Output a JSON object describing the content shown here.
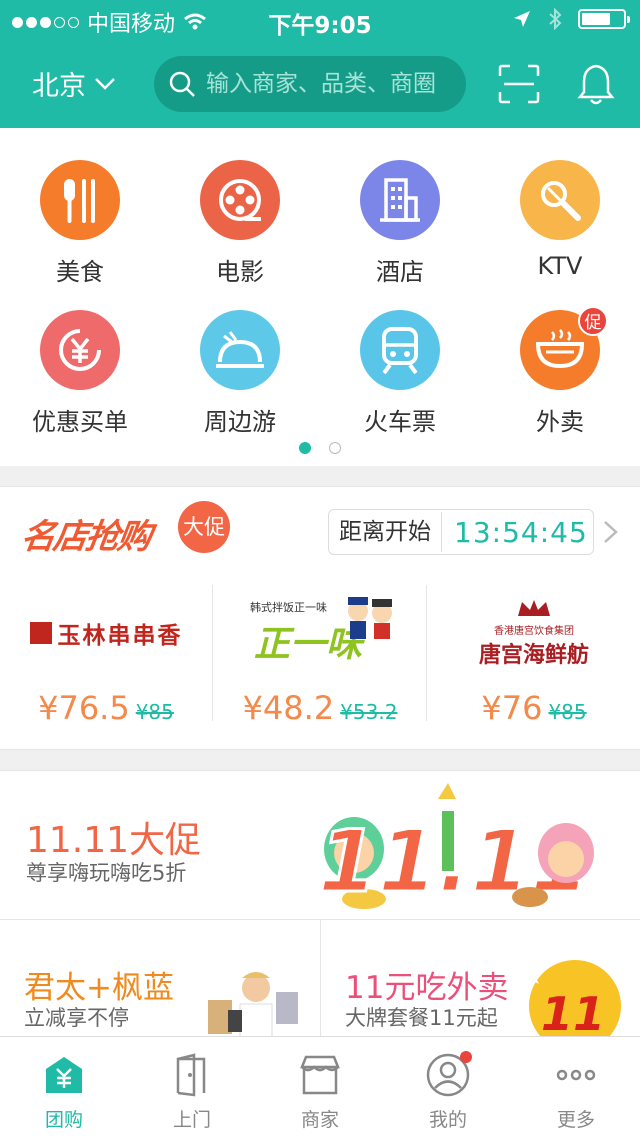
{
  "status_bar": {
    "carrier": "中国移动",
    "time": "下午9:05"
  },
  "nav": {
    "city": "北京",
    "search_placeholder": "输入商家、品类、商圈"
  },
  "categories": [
    {
      "label": "美食",
      "color": "#f47c2a",
      "icon": "utensils-icon"
    },
    {
      "label": "电影",
      "color": "#ec6447",
      "icon": "film-reel-icon"
    },
    {
      "label": "酒店",
      "color": "#7b86e8",
      "icon": "building-icon"
    },
    {
      "label": "KTV",
      "color": "#f7b54a",
      "icon": "microphone-icon"
    },
    {
      "label": "优惠买单",
      "color": "#ef6b6b",
      "icon": "yuan-coupon-icon"
    },
    {
      "label": "周边游",
      "color": "#5ec8e8",
      "icon": "travel-icon"
    },
    {
      "label": "火车票",
      "color": "#59c6e9",
      "icon": "train-icon"
    },
    {
      "label": "外卖",
      "color": "#f47c2a",
      "icon": "bowl-icon",
      "badge": "促"
    }
  ],
  "flash_sale": {
    "title": "名店抢购",
    "badge": "大促",
    "countdown_label": "距离开始",
    "countdown": "13:54:45",
    "deals": [
      {
        "brand": "玉林串串香",
        "price": "¥76.5",
        "old_price": "¥85"
      },
      {
        "brand": "正一味",
        "brand_sub": "韩式拌饭正一味",
        "price": "¥48.2",
        "old_price": "¥53.2"
      },
      {
        "brand": "唐宫海鲜舫",
        "brand_sub": "香港唐宫饮食集团",
        "price": "¥76",
        "old_price": "¥85"
      }
    ]
  },
  "promo_banner": {
    "title": "11.11大促",
    "subtitle": "尊享嗨玩嗨吃5折",
    "art_text": "11.11"
  },
  "banners": [
    {
      "title": "君太+枫蓝",
      "subtitle": "立减享不停",
      "title_color": "#f08a1e"
    },
    {
      "title": "11元吃外卖",
      "subtitle": "大牌套餐11元起",
      "title_color": "#ec4f7a"
    }
  ],
  "tabs": [
    {
      "label": "团购",
      "icon": "group-buy-icon",
      "active": true
    },
    {
      "label": "上门",
      "icon": "door-icon"
    },
    {
      "label": "商家",
      "icon": "store-icon"
    },
    {
      "label": "我的",
      "icon": "profile-icon",
      "dot": true
    },
    {
      "label": "更多",
      "icon": "more-icon"
    }
  ]
}
